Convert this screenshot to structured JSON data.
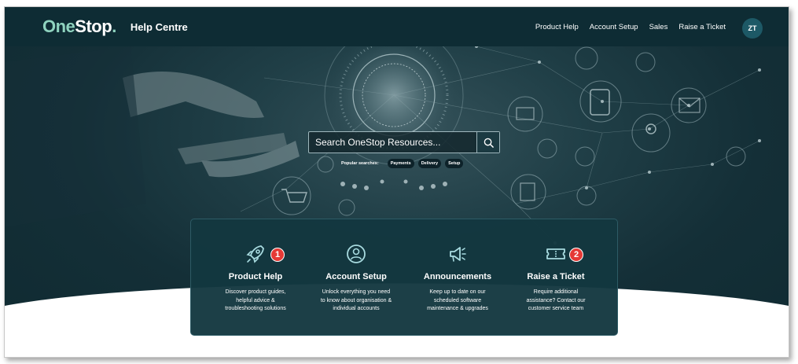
{
  "header": {
    "logo_one": "One",
    "logo_stop": "Stop",
    "logo_dot": ".",
    "title": "Help Centre",
    "nav": [
      {
        "label": "Product Help"
      },
      {
        "label": "Account Setup"
      },
      {
        "label": "Sales"
      },
      {
        "label": "Raise a Ticket"
      }
    ],
    "avatar_initials": "ZT"
  },
  "search": {
    "placeholder": "Search OneStop Resources...",
    "icon": "search-icon",
    "popular_label": "Popular searches:",
    "popular": [
      "Payments",
      "Delivery",
      "Setup"
    ]
  },
  "cards": [
    {
      "icon": "rocket-icon",
      "title": "Product Help",
      "desc1": "Discover product guides,",
      "desc2": "helpful advice &",
      "desc3": "troubleshooting solutions",
      "badge": "1"
    },
    {
      "icon": "user-circle-icon",
      "title": "Account Setup",
      "desc1": "Unlock everything you need",
      "desc2": "to know about organisation &",
      "desc3": "individual accounts",
      "badge": ""
    },
    {
      "icon": "megaphone-icon",
      "title": "Announcements",
      "desc1": "Keep up to date on our",
      "desc2": "scheduled software",
      "desc3": "maintenance & upgrades",
      "badge": ""
    },
    {
      "icon": "ticket-icon",
      "title": "Raise a Ticket",
      "desc1": "Require additional",
      "desc2": "assistance? Contact our",
      "desc3": "customer service team",
      "badge": "2"
    }
  ],
  "colors": {
    "header_bg": "#0e2c34",
    "accent_teal": "#8fd3bf",
    "icon_light": "#a8dbe0",
    "badge_red": "#e53935"
  }
}
